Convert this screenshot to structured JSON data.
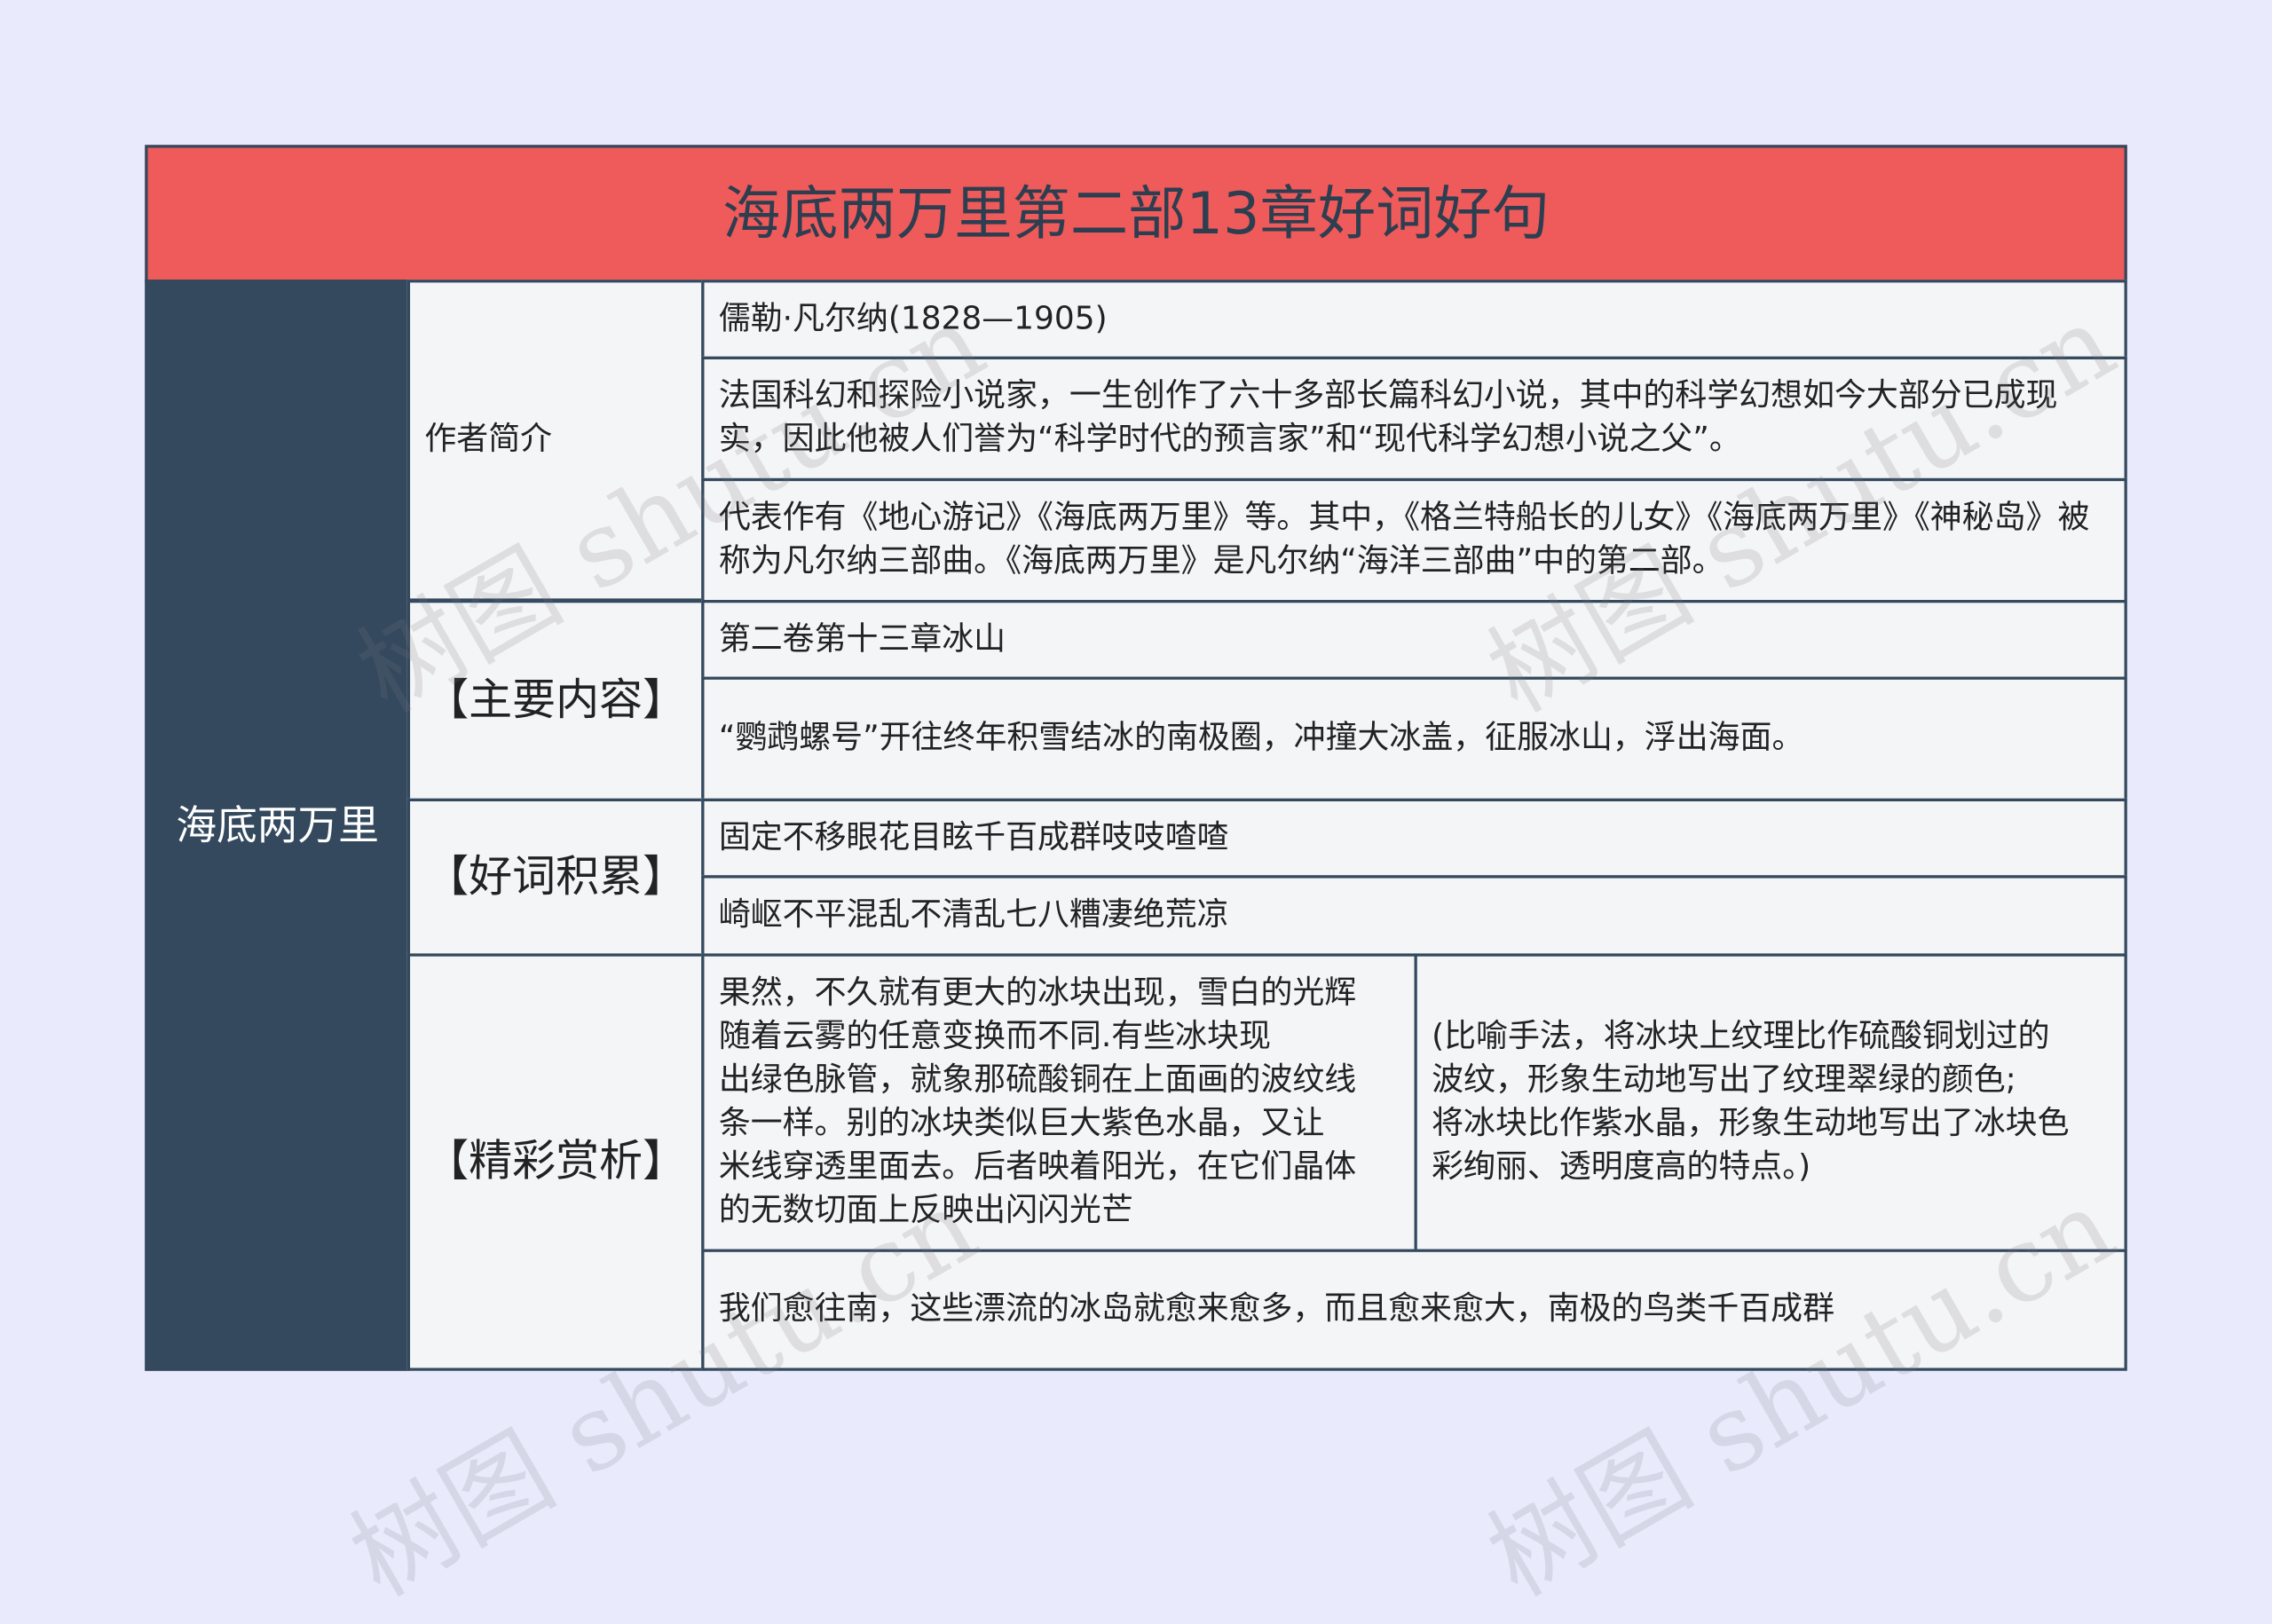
{
  "title": "海底两万里第二部13章好词好句",
  "root": "海底两万里",
  "sections": {
    "author": {
      "label": "作者简介",
      "items": [
        "儒勒·凡尔纳(1828—1905)",
        "法国科幻和探险小说家，一生创作了六十多部长篇科幻小说，其中的科学幻想如今大部分已成现实，因此他被人们誉为“科学时代的预言家”和“现代科学幻想小说之父”。",
        "代表作有《地心游记》《海底两万里》等。其中，《格兰特船长的儿女》《海底两万里》《神秘岛》被称为凡尔纳三部曲。《海底两万里》是凡尔纳“海洋三部曲”中的第二部。"
      ]
    },
    "content": {
      "label": "【主要内容】",
      "items": [
        "第二卷第十三章冰山",
        "“鹦鹉螺号”开往终年积雪结冰的南极圈，冲撞大冰盖，征服冰山，浮出海面。"
      ]
    },
    "words": {
      "label": "【好词积累】",
      "items": [
        "固定不移眼花目眩千百成群吱吱喳喳",
        "崎岖不平混乱不清乱七八糟凄绝荒凉"
      ]
    },
    "analysis": {
      "label": "【精彩赏析】",
      "quote_lines": [
        "果然，不久就有更大的冰块出现，雪白的光辉",
        "随着云雾的任意变换而不同.有些冰块现",
        "出绿色脉管，就象那硫酸铜在上面画的波纹线",
        "条一样。别的冰块类似巨大紫色水晶，又让",
        "米线穿透里面去。后者映着阳光，在它们晶体",
        "的无数切面上反映出闪闪光芒"
      ],
      "comment_lines": [
        "(比喻手法，将冰块上纹理比作硫酸铜划过的",
        "波纹，形象生动地写出了纹理翠绿的颜色;",
        "将冰块比作紫水晶，形象生动地写出了冰块色",
        "彩绚丽、透明度高的特点。)"
      ],
      "last": "我们愈往南，这些漂流的冰岛就愈来愈多，而且愈来愈大，南极的鸟类千百成群"
    }
  },
  "watermark": "树图 shutu.cn",
  "colors": {
    "background": "#e9ebfd",
    "title_bg": "#ef5a5a",
    "root_bg": "#34495e",
    "border": "#34495e",
    "cell_bg": "#f4f5f7"
  }
}
